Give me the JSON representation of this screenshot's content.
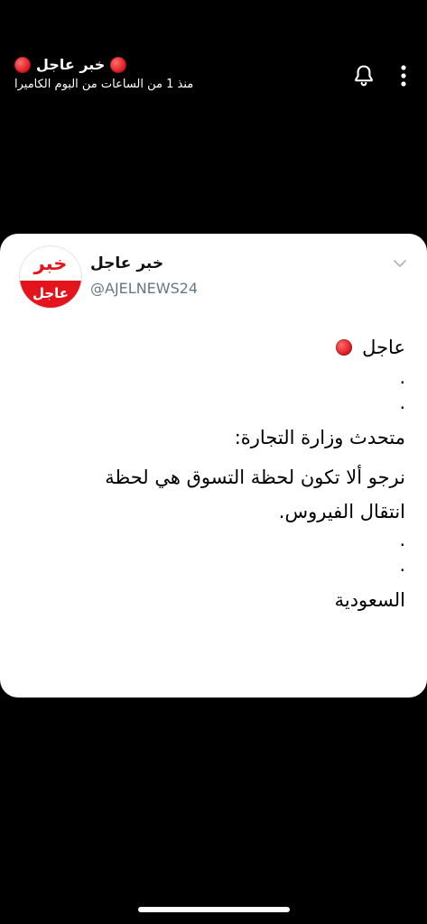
{
  "story": {
    "title": "خبر عاجل",
    "subtitle": "منذ 1 من الساعات من البوم الكاميرا",
    "icons": [
      "bell-icon",
      "more-vertical-icon"
    ]
  },
  "tweet": {
    "avatar": {
      "top_text": "خبر",
      "bottom_text": "عاجل"
    },
    "name": "خبر عاجل",
    "handle": "@AJELNEWS24",
    "lines": [
      "عاجل",
      ".",
      ".",
      "متحدث وزارة التجارة:",
      "نرجو ألا تكون لحظة التسوق هي لحظة",
      "انتقال الفيروس.",
      ".",
      ".",
      "السعودية"
    ]
  },
  "colors": {
    "accent_red": "#e3141b",
    "handle_gray": "#657786",
    "background": "#000000",
    "card": "#ffffff"
  }
}
